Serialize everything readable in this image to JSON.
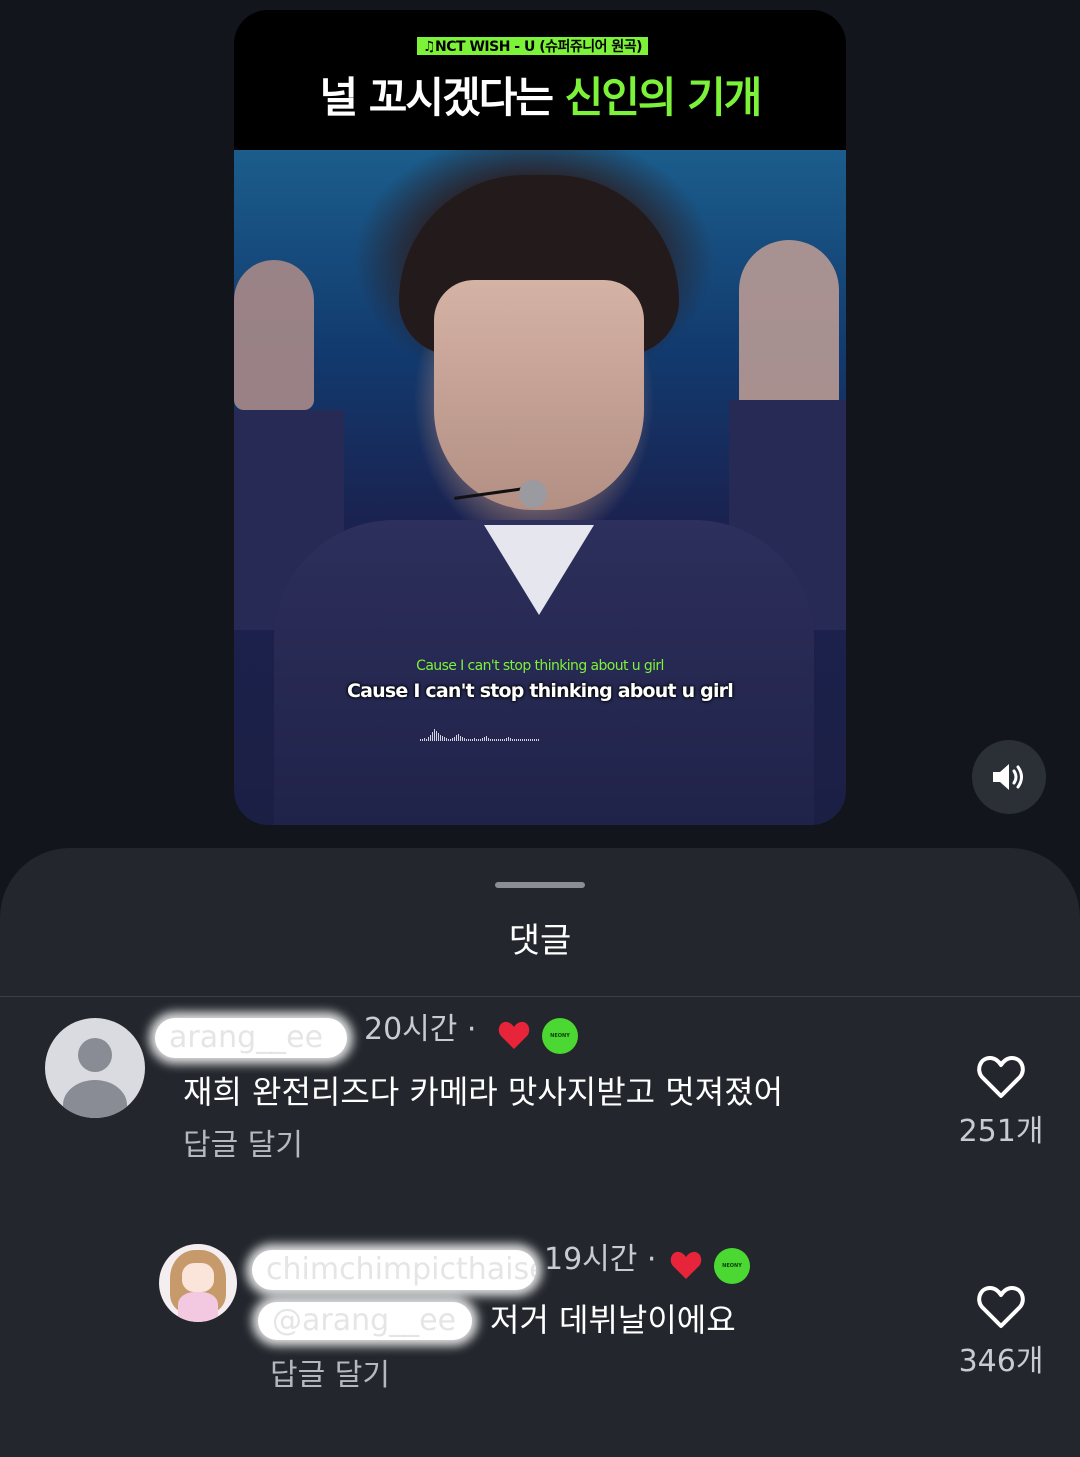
{
  "video": {
    "song_tag": "♫NCT WISH - U (슈퍼쥬니어 원곡)",
    "headline_white": "널 꼬시겠다는 ",
    "headline_green": "신인의 기개",
    "lyric_small": "Cause I can't stop thinking about u girl",
    "lyric_main": "Cause I can't stop thinking about u girl",
    "sound_icon": "speaker-volume-icon",
    "accent_color": "#7cf239"
  },
  "sheet": {
    "title": "댓글"
  },
  "comments": [
    {
      "username": "arang__ee",
      "time": "20시간 ·",
      "text": "재희 완전리즈다 카메라 맛사지받고 멋져졌어",
      "reply_label": "답글 달기",
      "like_count": "251개",
      "badge": "NEONY"
    },
    {
      "username": "chimchimpicthaise",
      "time": "19시간 ·",
      "mention": "@arang__ee",
      "text": "저거 데뷔날이에요",
      "reply_label": "답글 달기",
      "like_count": "346개",
      "badge": "NEONY"
    }
  ],
  "colors": {
    "heart_red": "#e8243a",
    "badge_green": "#4cd832"
  }
}
